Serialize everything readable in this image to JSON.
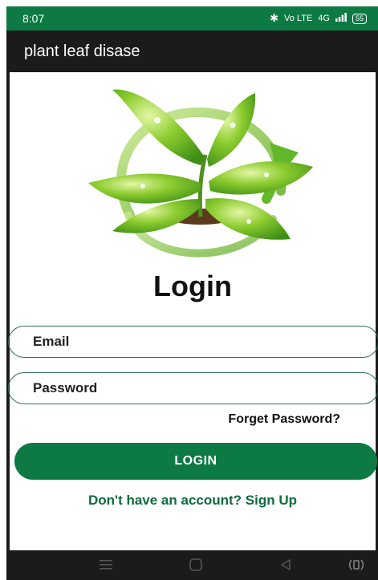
{
  "status_bar": {
    "time": "8:07",
    "bluetooth_icon": "bluetooth-icon",
    "volte_text": "Vo LTE",
    "network_text": "4G",
    "battery_level": "55"
  },
  "app_bar": {
    "title": "plant leaf disase"
  },
  "login": {
    "logo_icon": "plant-leaf-logo",
    "title": "Login",
    "email_placeholder": "Email",
    "email_value": "",
    "password_placeholder": "Password",
    "password_value": "",
    "forget_password": "Forget Password?",
    "login_button": "LOGIN",
    "signup_link": "Don't have an account? Sign Up"
  },
  "colors": {
    "brand_green": "#0d7a43",
    "dark_bar": "#1b1b1b",
    "field_border": "#2f6e55",
    "signup_text": "#0d6b3c"
  },
  "nav_bar": {
    "menu_icon": "menu-icon",
    "home_icon": "home-icon",
    "back_icon": "back-icon",
    "extra_icon": "accessibility-icon"
  }
}
